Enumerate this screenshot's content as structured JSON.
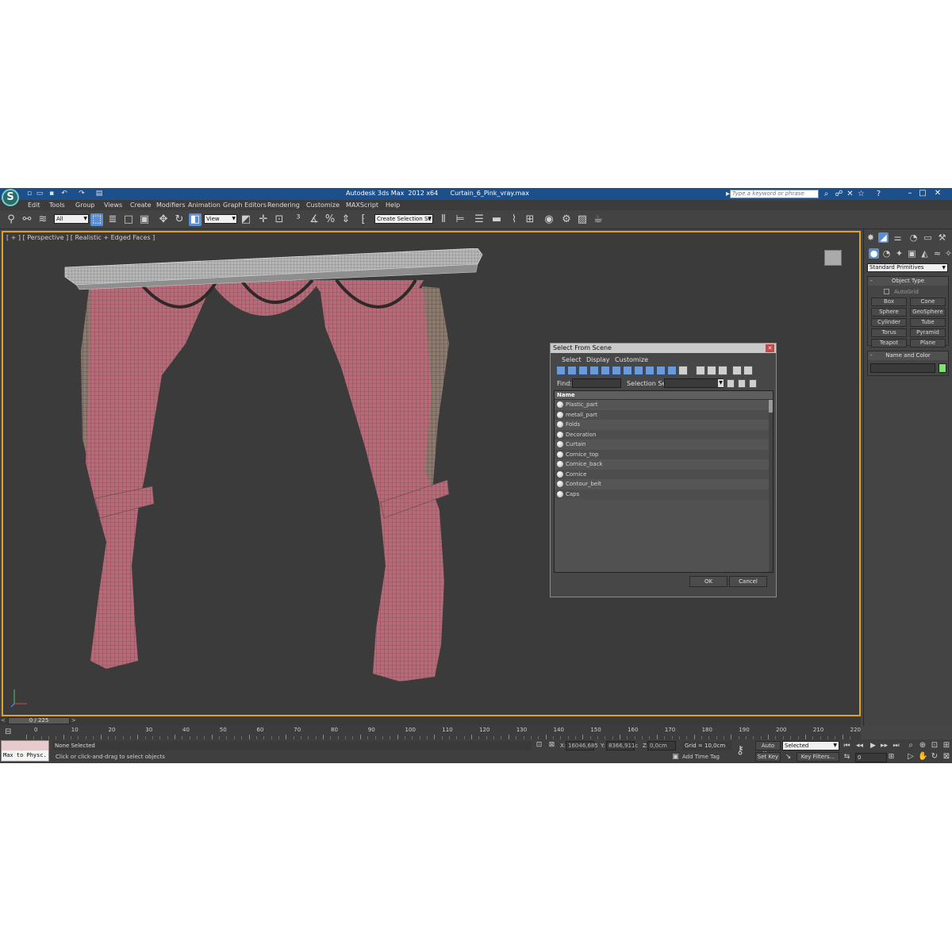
{
  "window": {
    "title": "Autodesk 3ds Max  2012 x64      Curtain_6_Pink_vray.max",
    "search_placeholder": "Type a keyword or phrase"
  },
  "menu": [
    "Edit",
    "Tools",
    "Group",
    "Views",
    "Create",
    "Modifiers",
    "Animation",
    "Graph Editors",
    "Rendering",
    "Customize",
    "MAXScript",
    "Help"
  ],
  "toolbar": {
    "filter_value": "All",
    "refcoord_value": "View",
    "selection_set_value": "Create Selection Se"
  },
  "viewport": {
    "label": "[ + ] [ Perspective ] [ Realistic + Edged Faces ]"
  },
  "dialog": {
    "title": "Select From Scene",
    "menu": [
      "Select",
      "Display",
      "Customize"
    ],
    "find_label": "Find:",
    "selection_set_label": "Selection Set:",
    "column_header": "Name",
    "objects": [
      "Plastic_part",
      "metall_part",
      "Folds",
      "Decoration",
      "Curtain",
      "Cornice_top",
      "Cornice_back",
      "Cornice",
      "Contour_belt",
      "Caps"
    ],
    "ok_label": "OK",
    "cancel_label": "Cancel"
  },
  "command_panel": {
    "category_value": "Standard Primitives",
    "object_type_title": "Object Type",
    "autogrid_label": "AutoGrid",
    "buttons": [
      "Box",
      "Cone",
      "Sphere",
      "GeoSphere",
      "Cylinder",
      "Tube",
      "Torus",
      "Pyramid",
      "Teapot",
      "Plane"
    ],
    "name_color_title": "Name and Color",
    "object_color": "#7ee070"
  },
  "timeline": {
    "frame_counter": "0 / 225",
    "ticks": [
      "0",
      "10",
      "20",
      "30",
      "40",
      "50",
      "60",
      "70",
      "80",
      "90",
      "100",
      "110",
      "120",
      "130",
      "140",
      "150",
      "160",
      "170",
      "180",
      "190",
      "200",
      "210",
      "220"
    ]
  },
  "status": {
    "maxscript_text": "Max to Physc.",
    "selection_status": "None Selected",
    "prompt": "Click or click-and-drag to select objects",
    "x_label": "X:",
    "x_value": "16046,685",
    "y_label": "Y:",
    "y_value": "8366,911c",
    "z_label": "Z:",
    "z_value": "0,0cm",
    "grid": "Grid = 10,0cm",
    "add_time_tag": "Add Time Tag",
    "auto_key": "Auto Key",
    "set_key": "Set Key",
    "selected_value": "Selected",
    "key_filters": "Key Filters...",
    "current_frame": "0"
  }
}
